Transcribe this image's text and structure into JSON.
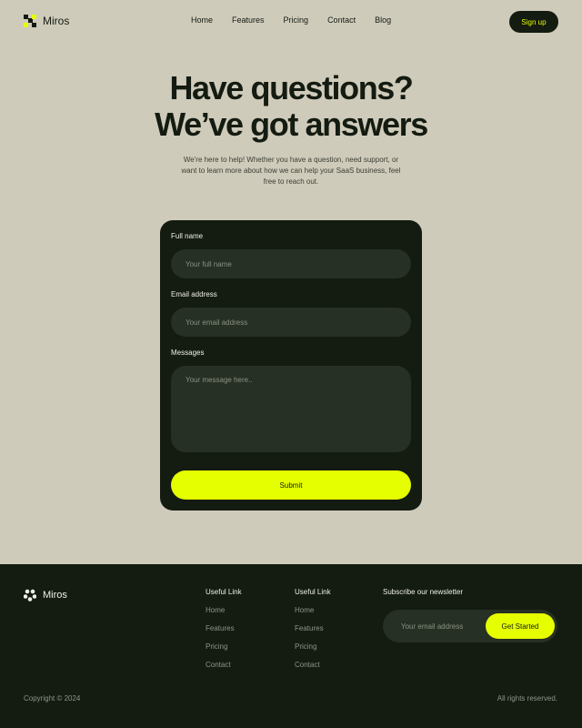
{
  "colors": {
    "page_bg": "#cfcbbb",
    "dark": "#141b11",
    "accent": "#e6ff00",
    "field_bg": "#273024"
  },
  "nav": {
    "brand": "Miros",
    "logo_icon": "checker-squares-icon",
    "links": [
      "Home",
      "Features",
      "Pricing",
      "Contact",
      "Blog"
    ],
    "signup_label": "Sign up"
  },
  "hero": {
    "title_line1": "Have questions?",
    "title_line2": "We’ve got answers",
    "subtitle": "We're here to help! Whether you have a question, need support, or want to learn more about how we can help your SaaS business, feel free to reach out."
  },
  "form": {
    "name_label": "Full name",
    "name_placeholder": "Your full name",
    "email_label": "Email address",
    "email_placeholder": "Your email address",
    "message_label": "Messages",
    "message_placeholder": "Your message here..",
    "submit_label": "Submit"
  },
  "footer": {
    "brand": "Miros",
    "logo_icon": "flower-dots-icon",
    "col1": {
      "title": "Useful Link",
      "links": [
        "Home",
        "Features",
        "Pricing",
        "Contact"
      ]
    },
    "col2": {
      "title": "Useful Link",
      "links": [
        "Home",
        "Features",
        "Pricing",
        "Contact"
      ]
    },
    "newsletter_title": "Subscribe our newsletter",
    "newsletter_placeholder": "Your email address",
    "newsletter_button": "Get Started",
    "copyright": "Copyright © 2024",
    "rights": "All rights reserved."
  }
}
